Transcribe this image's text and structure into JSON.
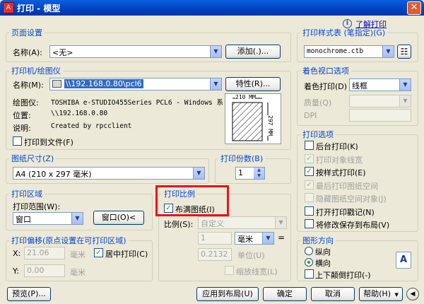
{
  "window": {
    "title": "打印 - 模型",
    "close_glyph": "✕",
    "app_icon_glyph": "A"
  },
  "help": {
    "info_glyph": "i",
    "learn_print": "了解打印"
  },
  "page_setup": {
    "legend": "页面设置",
    "name_label": "名称(A):",
    "name_value": "<无>",
    "add_button": "添加(.)..."
  },
  "printer": {
    "legend": "打印机/绘图仪",
    "name_label": "名称(M):",
    "name_value": "\\\\192.168.0.80\\pcl6",
    "properties_button": "特性(R)...",
    "plotter_label": "绘图仪:",
    "plotter_value": "TOSHIBA e-STUDIO455Series PCL6 - Windows 系...",
    "location_label": "位置:",
    "location_value": "\\\\192.168.0.80",
    "description_label": "说明:",
    "description_value": "Created by rpcclient",
    "print_to_file": "打印到文件(F)",
    "preview_width": "210 MM",
    "preview_height": "297 MM"
  },
  "paper_size": {
    "legend": "图纸尺寸(Z)",
    "value": "A4 (210 x 297 毫米)"
  },
  "copies": {
    "legend": "打印份数(B)",
    "value": "1"
  },
  "print_area": {
    "legend": "打印区域",
    "range_label": "打印范围(W):",
    "range_value": "窗口",
    "window_button": "窗口(O)<"
  },
  "print_offset": {
    "legend": "打印偏移(原点设置在可打印区域)",
    "x_label": "X:",
    "x_value": "21.06",
    "x_unit": "毫米",
    "y_label": "Y:",
    "y_value": "0.00",
    "y_unit": "毫米",
    "center_print": "居中打印(C)"
  },
  "print_scale": {
    "legend": "打印比例",
    "fit_to_paper": "布满图纸(I)",
    "scale_label": "比例(S):",
    "scale_value": "自定义",
    "value1": "1",
    "unit1": "毫米",
    "equals": "=",
    "value2": "0.2132",
    "unit2": "单位(U)",
    "scale_lineweights": "缩放线宽(L)"
  },
  "plot_style": {
    "legend": "打印样式表 (笔指定)(G)",
    "value": "monochrome.ctb",
    "edit_glyph": "☷"
  },
  "shaded_viewport": {
    "legend": "着色视口选项",
    "shade_label": "着色打印(D)",
    "shade_value": "线框",
    "quality_label": "质量(Q)",
    "dpi_label": "DPI"
  },
  "plot_options": {
    "legend": "打印选项",
    "items": [
      {
        "label": "后台打印(K)",
        "checked": false,
        "enabled": true
      },
      {
        "label": "打印对象线宽",
        "checked": true,
        "enabled": false
      },
      {
        "label": "按样式打印(E)",
        "checked": true,
        "enabled": true
      },
      {
        "label": "最后打印图纸空间",
        "checked": true,
        "enabled": false
      },
      {
        "label": "隐藏图纸空间对象(J)",
        "checked": false,
        "enabled": false
      },
      {
        "label": "打开打印戳记(N)",
        "checked": false,
        "enabled": true
      },
      {
        "label": "将修改保存到布局(V)",
        "checked": false,
        "enabled": true
      }
    ]
  },
  "orientation": {
    "legend": "图形方向",
    "portrait": "纵向",
    "landscape": "横向",
    "upside_down": "上下颠倒打印(-)",
    "preview_letter": "A"
  },
  "footer": {
    "preview_button": "预览(P)...",
    "apply_layout_button": "应用到布局(U)",
    "ok_button": "确定",
    "cancel_button": "取消",
    "help_button": "帮助(H)",
    "more_glyph": "◀"
  },
  "glyphs": {
    "check": "✓",
    "dropdown": "▼",
    "spin_up": "▲",
    "spin_down": "▼"
  }
}
